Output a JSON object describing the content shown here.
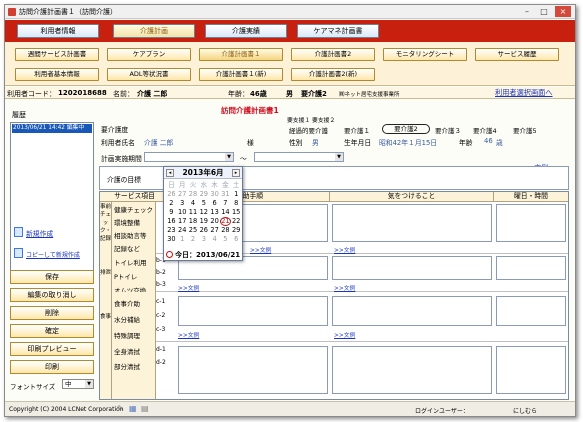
{
  "window": {
    "title": "訪問介護計画書１（訪問介護）",
    "min": "–",
    "max": "□",
    "close": "×"
  },
  "menu": [
    "利用者情報",
    "介護計画",
    "介護実績",
    "ケアマネ計画書"
  ],
  "menu2_row1": [
    "週間サービス計画書",
    "ケアプラン",
    "介護計画書１",
    "介護計画書2",
    "モニタリングシート",
    "サービス履歴"
  ],
  "menu2_row2": [
    "利用者基本情報",
    "ADL等状況書",
    "介護計画書１(新)",
    "介護計画書2(新)"
  ],
  "info": {
    "code_label": "利用者コード：",
    "code": "1202018688",
    "name_label": "名前：",
    "name": "介護 二郎",
    "age_label": "年齢：",
    "age": "46歳",
    "sex": "男",
    "care_level": "要介護2",
    "office": "㈱ネット居宅支援事業所",
    "link": "利用者選択画面へ"
  },
  "left": {
    "history_label": "履歴",
    "history_item": "2013/06/21 14:42 編集中",
    "new_link": "新規作成",
    "copy_link": "コピーして新規作成",
    "save": "保存",
    "cancel": "編集の取り消し",
    "delete": "削除",
    "confirm": "確定",
    "preview": "印刷プレビュー",
    "print": "印刷",
    "font_label": "フォントサイズ",
    "font_value": "中"
  },
  "form": {
    "title": "訪問介護計画書1",
    "support_top": "要支援１  要支援２",
    "care_level_label": "要介護度",
    "plan_options": [
      "経過的要介護",
      "要介護１",
      "要介護2",
      "要介護３",
      "要介護4",
      "要介護5"
    ],
    "user_label": "利用者氏名",
    "user_name": "介護  二郎",
    "sama": "様",
    "sex_label": "性別",
    "sex": "男",
    "birth_label": "生年月日",
    "birth": "昭和42年１月15日",
    "age_label": "年齢",
    "age": "46",
    "age_unit": "歳",
    "period_label": "計画実施期間",
    "tilde": "～",
    "goal_label": "介護の目標",
    "bunrei": ">>文例"
  },
  "table": {
    "headers": [
      "サービス項目",
      "接助手順",
      "気をつけること",
      "曜日・時間"
    ],
    "groups": [
      {
        "cat": "事前チェック・記録",
        "items": [
          {
            "name": "健康チェック",
            "code": "a-1"
          },
          {
            "name": "環境整備",
            "code": "a-2"
          },
          {
            "name": "相談助言等",
            "code": "a-3"
          },
          {
            "name": "記録など",
            "code": "a-4"
          }
        ]
      },
      {
        "cat": "排泄",
        "items": [
          {
            "name": "トイレ利用",
            "code": "b-1"
          },
          {
            "name": "Pトイレ",
            "code": "b-2"
          },
          {
            "name": "オムツ交換",
            "code": "b-3"
          }
        ]
      },
      {
        "cat": "食事",
        "items": [
          {
            "name": "食事介助",
            "code": "c-1"
          },
          {
            "name": "水分補給",
            "code": "c-2"
          },
          {
            "name": "特殊調理",
            "code": "c-3"
          }
        ]
      },
      {
        "cat": "",
        "items": [
          {
            "name": "全身清拭",
            "code": "d-1"
          },
          {
            "name": "部分清拭",
            "code": "d-2"
          }
        ]
      }
    ],
    "bunrei": ">>文例"
  },
  "calendar": {
    "month": "2013年6月",
    "prev": "◂",
    "next": "▸",
    "weekdays": [
      "日",
      "月",
      "火",
      "水",
      "木",
      "金",
      "土"
    ],
    "rows": [
      [
        "26",
        "27",
        "28",
        "29",
        "30",
        "31",
        "1"
      ],
      [
        "2",
        "3",
        "4",
        "5",
        "6",
        "7",
        "8"
      ],
      [
        "9",
        "10",
        "11",
        "12",
        "13",
        "14",
        "15"
      ],
      [
        "16",
        "17",
        "18",
        "19",
        "20",
        "21",
        "22"
      ],
      [
        "23",
        "24",
        "25",
        "26",
        "27",
        "28",
        "29"
      ],
      [
        "30",
        "1",
        "2",
        "3",
        "4",
        "5",
        "6"
      ]
    ],
    "today_text": "今日：2013/06/21"
  },
  "status": {
    "copyright": "Copyright (C) 2004 LCNet Corporation",
    "login_label": "ログインユーザー：",
    "login_user": "にしむら"
  }
}
